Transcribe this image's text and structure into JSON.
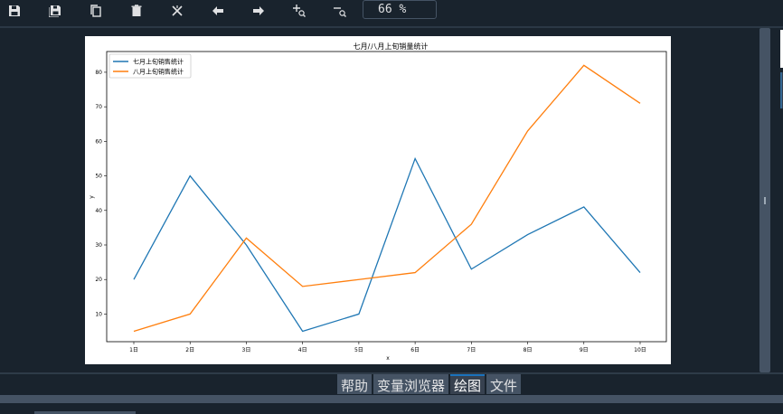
{
  "toolbar": {
    "buttons": [
      {
        "icon": "save-icon"
      },
      {
        "icon": "save-all-icon"
      },
      {
        "icon": "copy-icon"
      },
      {
        "icon": "delete-icon"
      },
      {
        "icon": "close-all-icon"
      },
      {
        "icon": "arrow-left-icon"
      },
      {
        "icon": "arrow-right-icon"
      },
      {
        "icon": "zoom-in-icon"
      },
      {
        "icon": "zoom-out-icon"
      }
    ],
    "zoom_value": "66 %"
  },
  "tabs": [
    {
      "label": "帮助",
      "active": false
    },
    {
      "label": "变量浏览器",
      "active": false
    },
    {
      "label": "绘图",
      "active": true
    },
    {
      "label": "文件",
      "active": false
    }
  ],
  "colors": {
    "background": "#19232d",
    "series1": "#1f77b4",
    "series2": "#ff7f0e",
    "active_tab_accent": "#1a72bb"
  },
  "chart_data": {
    "type": "line",
    "title": "七月/八月上旬销量统计",
    "xlabel": "x",
    "ylabel": "y",
    "categories": [
      "1日",
      "2日",
      "3日",
      "4日",
      "5日",
      "6日",
      "7日",
      "8日",
      "9日",
      "10日"
    ],
    "yticks": [
      10,
      20,
      30,
      40,
      50,
      60,
      70,
      80
    ],
    "ylim": [
      2,
      86
    ],
    "legend_position": "top-left",
    "series": [
      {
        "name": "七月上旬销售统计",
        "color": "#1f77b4",
        "values": [
          20,
          50,
          30,
          5,
          10,
          55,
          23,
          33,
          41,
          22
        ]
      },
      {
        "name": "八月上旬销售统计",
        "color": "#ff7f0e",
        "values": [
          5,
          10,
          32,
          18,
          20,
          22,
          36,
          63,
          82,
          71
        ]
      }
    ]
  }
}
